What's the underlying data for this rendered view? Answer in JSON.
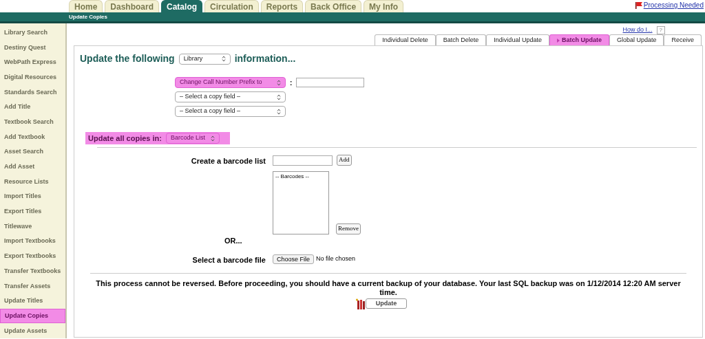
{
  "top_tabs": [
    {
      "label": "Home",
      "selected": false
    },
    {
      "label": "Dashboard",
      "selected": false
    },
    {
      "label": "Catalog",
      "selected": true
    },
    {
      "label": "Circulation",
      "selected": false
    },
    {
      "label": "Reports",
      "selected": false
    },
    {
      "label": "Back Office",
      "selected": false
    },
    {
      "label": "My Info",
      "selected": false
    }
  ],
  "processing_link": "Processing Needed",
  "subnav": "Update Copies",
  "sidebar": {
    "items": [
      {
        "label": "Library Search",
        "selected": false
      },
      {
        "label": "Destiny Quest",
        "selected": false
      },
      {
        "label": "WebPath Express",
        "selected": false
      },
      {
        "label": "Digital Resources",
        "selected": false
      },
      {
        "label": "Standards Search",
        "selected": false
      },
      {
        "label": "Add Title",
        "selected": false
      },
      {
        "label": "Textbook Search",
        "selected": false
      },
      {
        "label": "Add Textbook",
        "selected": false
      },
      {
        "label": "Asset Search",
        "selected": false
      },
      {
        "label": "Add Asset",
        "selected": false
      },
      {
        "label": "Resource Lists",
        "selected": false
      },
      {
        "label": "Import Titles",
        "selected": false
      },
      {
        "label": "Export Titles",
        "selected": false
      },
      {
        "label": "Titlewave",
        "selected": false
      },
      {
        "label": "Import Textbooks",
        "selected": false
      },
      {
        "label": "Export Textbooks",
        "selected": false
      },
      {
        "label": "Transfer Textbooks",
        "selected": false
      },
      {
        "label": "Transfer Assets",
        "selected": false
      },
      {
        "label": "Update Titles",
        "selected": false
      },
      {
        "label": "Update Copies",
        "selected": true
      },
      {
        "label": "Update Assets",
        "selected": false
      }
    ]
  },
  "help_link": "How do I...",
  "help_icon": "?",
  "sub_tabs": [
    {
      "label": "Individual Delete",
      "selected": false
    },
    {
      "label": "Batch Delete",
      "selected": false
    },
    {
      "label": "Individual Update",
      "selected": false
    },
    {
      "label": "Batch Update",
      "selected": true
    },
    {
      "label": "Global Update",
      "selected": false
    },
    {
      "label": "Receive",
      "selected": false
    }
  ],
  "heading": {
    "before": "Update the following",
    "select": "Library",
    "after": "information..."
  },
  "copy_fields": [
    {
      "value": "Change Call Number Prefix to",
      "highlighted": true,
      "separator": ":"
    },
    {
      "value": "– Select a copy field –",
      "highlighted": false
    },
    {
      "value": "– Select a copy field –",
      "highlighted": false
    }
  ],
  "update_in": {
    "label": "Update all copies in:",
    "select": "Barcode List",
    "highlighted": true
  },
  "barcode_list": {
    "label": "Create a barcode list",
    "add_button": "Add",
    "list_items": [
      "-- Barcodes --"
    ],
    "remove_button": "Remove"
  },
  "or_text": "OR...",
  "barcode_file": {
    "label": "Select a barcode file",
    "button": "Choose File",
    "status": "No file chosen"
  },
  "warning": "This process cannot be reversed. Before proceeding, you should have a current backup of your database. Your last SQL backup was on 1/12/2014 12:20 AM server time.",
  "update_button": "Update"
}
